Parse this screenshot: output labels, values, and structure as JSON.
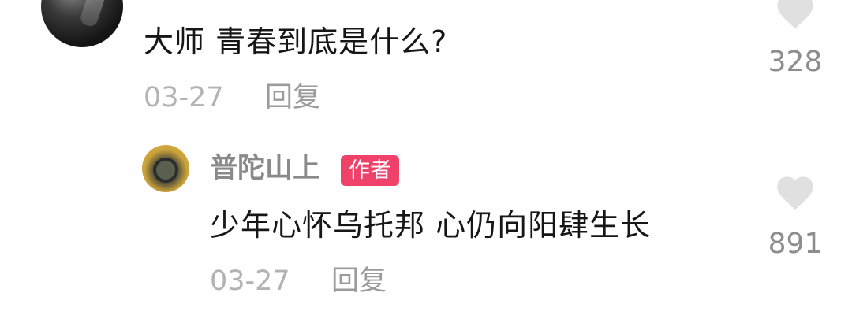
{
  "comment": {
    "text": "大师  青春到底是什么?",
    "date": "03-27",
    "reply_label": "回复",
    "like_count": "328"
  },
  "reply": {
    "username": "普陀山上",
    "badge": "作者",
    "text": "少年心怀乌托邦 心仍向阳肆生长",
    "date": "03-27",
    "reply_label": "回复",
    "like_count": "891"
  },
  "colors": {
    "badge_bg": "#f0416a",
    "heart": "#e0e0e0",
    "meta_text": "#b3b3b3"
  },
  "icons": {
    "like": "heart-icon"
  }
}
